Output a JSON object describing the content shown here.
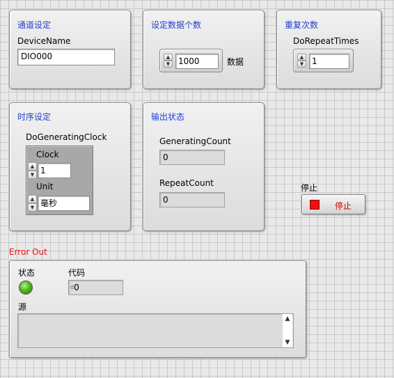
{
  "channel": {
    "title": "通道设定",
    "device_label": "DeviceName",
    "device_value": "DIO000"
  },
  "data_count": {
    "title": "设定数据个数",
    "value": "1000",
    "unit": "数据"
  },
  "repeat": {
    "title": "重复次数",
    "label": "DoRepeatTimes",
    "value": "1"
  },
  "timing": {
    "title": "时序设定",
    "cluster_label": "DoGeneratingClock",
    "clock_label": "Clock",
    "clock_value": "1",
    "unit_label": "Unit",
    "unit_value": "毫秒"
  },
  "output": {
    "title": "输出状态",
    "gen_label": "GeneratingCount",
    "gen_value": "0",
    "rep_label": "RepeatCount",
    "rep_value": "0"
  },
  "stop": {
    "label": "停止",
    "button_text": "停止",
    "color": "#ee1111"
  },
  "error": {
    "title": "Error Out",
    "status_label": "状态",
    "code_label": "代码",
    "code_value": "0",
    "code_prefix": "d",
    "source_label": "源",
    "source_value": "",
    "led_color": "#4fb81e"
  },
  "colors": {
    "title_blue": "#1f3fd0",
    "error_red": "#ee1111"
  }
}
